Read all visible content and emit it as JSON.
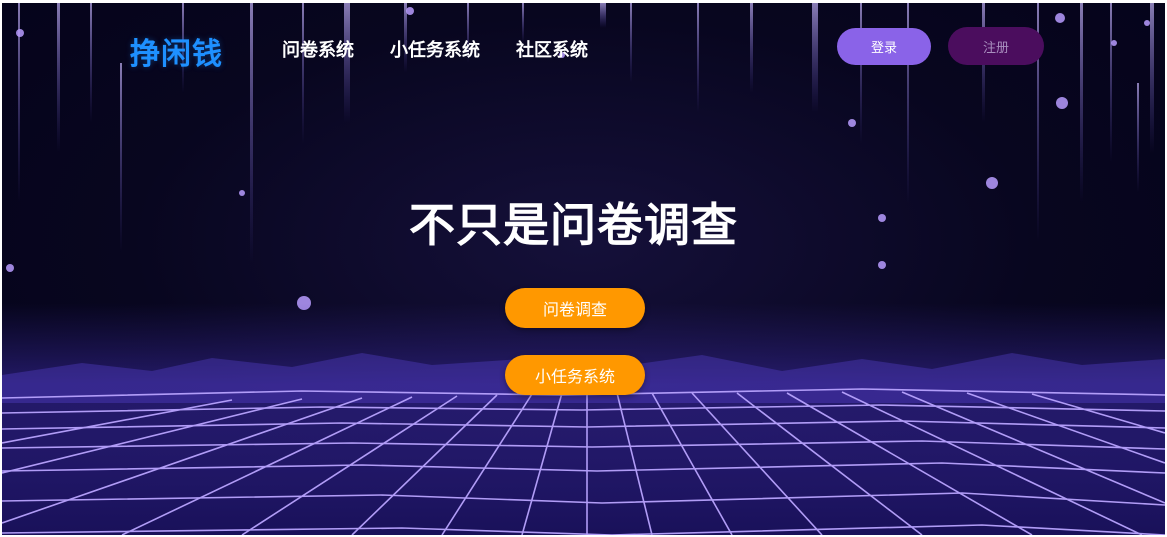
{
  "header": {
    "logo": "挣闲钱",
    "nav": [
      "问卷系统",
      "小任务系统",
      "社区系统"
    ],
    "login_label": "登录",
    "register_label": "注册"
  },
  "hero": {
    "title": "不只是问卷调查",
    "cta_survey": "问卷调查",
    "cta_tasks": "小任务系统"
  },
  "colors": {
    "logo": "#1e90ff",
    "login_button": "#8a63e8",
    "register_button": "#4b0d5e",
    "cta_button": "#ff9800",
    "background": "#08061f",
    "grid_lines": "#b9a4ff"
  }
}
